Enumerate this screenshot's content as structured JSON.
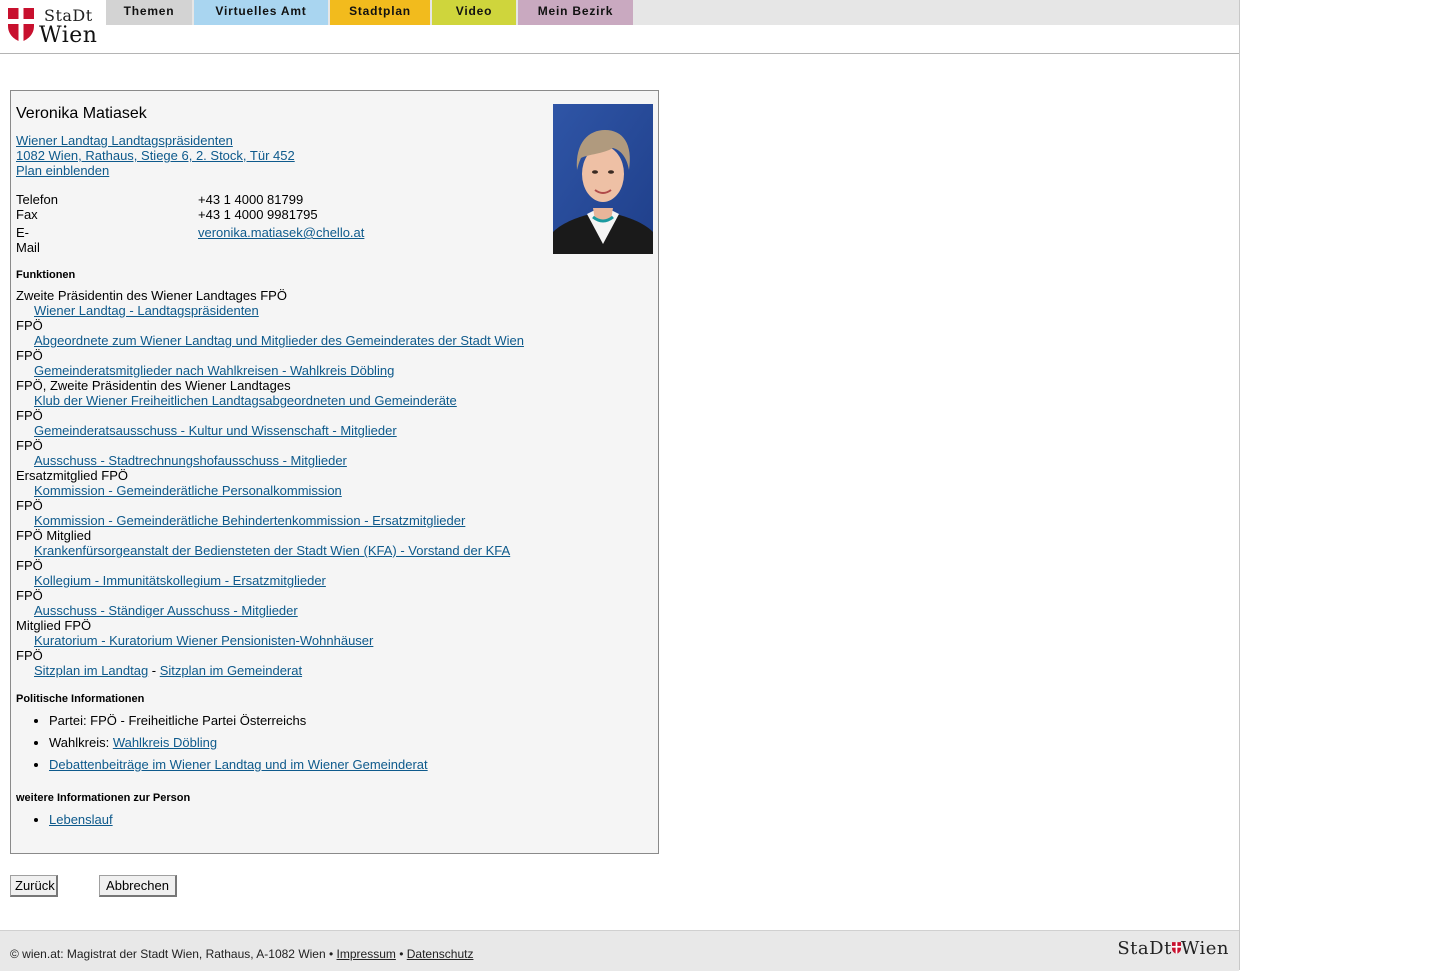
{
  "header": {
    "logo_top": "StaDt",
    "logo_bottom": "Wien",
    "tabs": [
      {
        "label": "Themen",
        "color": "#d3d3d3"
      },
      {
        "label": "Virtuelles Amt",
        "color": "#a9d5f0"
      },
      {
        "label": "Stadtplan",
        "color": "#f2bb1d"
      },
      {
        "label": "Video",
        "color": "#cfd53c"
      },
      {
        "label": "Mein Bezirk",
        "color": "#c9a9c0"
      }
    ]
  },
  "person": {
    "name": "Veronika Matiasek",
    "address_links": [
      "Wiener Landtag Landtagspräsidenten",
      "1082 Wien, Rathaus, Stiege 6, 2. Stock, Tür 452",
      "Plan einblenden"
    ],
    "contact": {
      "phone_label": "Telefon",
      "phone": "+43 1 4000 81799",
      "fax_label": "Fax",
      "fax": "+43 1 4000 9981795",
      "email_label": "E-Mail",
      "email": "veronika.matiasek@chello.at"
    }
  },
  "functions": {
    "heading": "Funktionen",
    "items": [
      {
        "title": "Zweite Präsidentin des Wiener Landtages FPÖ",
        "link": "Wiener Landtag - Landtagspräsidenten"
      },
      {
        "title": "FPÖ",
        "link": "Abgeordnete zum Wiener Landtag und Mitglieder des Gemeinderates der Stadt Wien"
      },
      {
        "title": "FPÖ",
        "link": "Gemeinderatsmitglieder nach Wahlkreisen - Wahlkreis Döbling"
      },
      {
        "title": "FPÖ, Zweite Präsidentin des Wiener Landtages",
        "link": "Klub der Wiener Freiheitlichen Landtagsabgeordneten und Gemeinderäte"
      },
      {
        "title": "FPÖ",
        "link": "Gemeinderatsausschuss - Kultur und Wissenschaft - Mitglieder"
      },
      {
        "title": "FPÖ",
        "link": "Ausschuss - Stadtrechnungshofausschuss - Mitglieder"
      },
      {
        "title": "Ersatzmitglied FPÖ",
        "link": "Kommission - Gemeinderätliche Personalkommission"
      },
      {
        "title": "FPÖ",
        "link": "Kommission - Gemeinderätliche Behindertenkommission - Ersatzmitglieder"
      },
      {
        "title": "FPÖ Mitglied",
        "link": "Krankenfürsorgeanstalt der Bediensteten der Stadt Wien (KFA) - Vorstand der KFA"
      },
      {
        "title": "FPÖ",
        "link": "Kollegium - Immunitätskollegium - Ersatzmitglieder"
      },
      {
        "title": "FPÖ",
        "link": "Ausschuss - Ständiger Ausschuss - Mitglieder"
      },
      {
        "title": "Mitglied FPÖ",
        "link": "Kuratorium - Kuratorium Wiener Pensionisten-Wohnhäuser"
      }
    ],
    "last_title": "FPÖ",
    "seat_plan_landtag": "Sitzplan im Landtag",
    "seat_plan_separator": " - ",
    "seat_plan_gemeinderat": "Sitzplan im Gemeinderat"
  },
  "political": {
    "heading": "Politische Informationen",
    "party": "Partei: FPÖ - Freiheitliche Partei Österreichs",
    "district_label": "Wahlkreis: ",
    "district_link": "Wahlkreis Döbling",
    "debates_link": "Debattenbeiträge im Wiener Landtag und im Wiener Gemeinderat"
  },
  "more": {
    "heading": "weitere Informationen zur Person",
    "cv_link": "Lebenslauf"
  },
  "buttons": {
    "back": "Zurück",
    "cancel": "Abbrechen"
  },
  "footer": {
    "text": "© wien.at: Magistrat der Stadt Wien, Rathaus, A-1082 Wien • ",
    "impressum": "Impressum",
    "separator": " • ",
    "datenschutz": "Datenschutz",
    "logo_left": "StaDt",
    "logo_right": "Wien"
  },
  "colors": {
    "link": "#0e5a8c",
    "brand_red": "#c8102e"
  }
}
